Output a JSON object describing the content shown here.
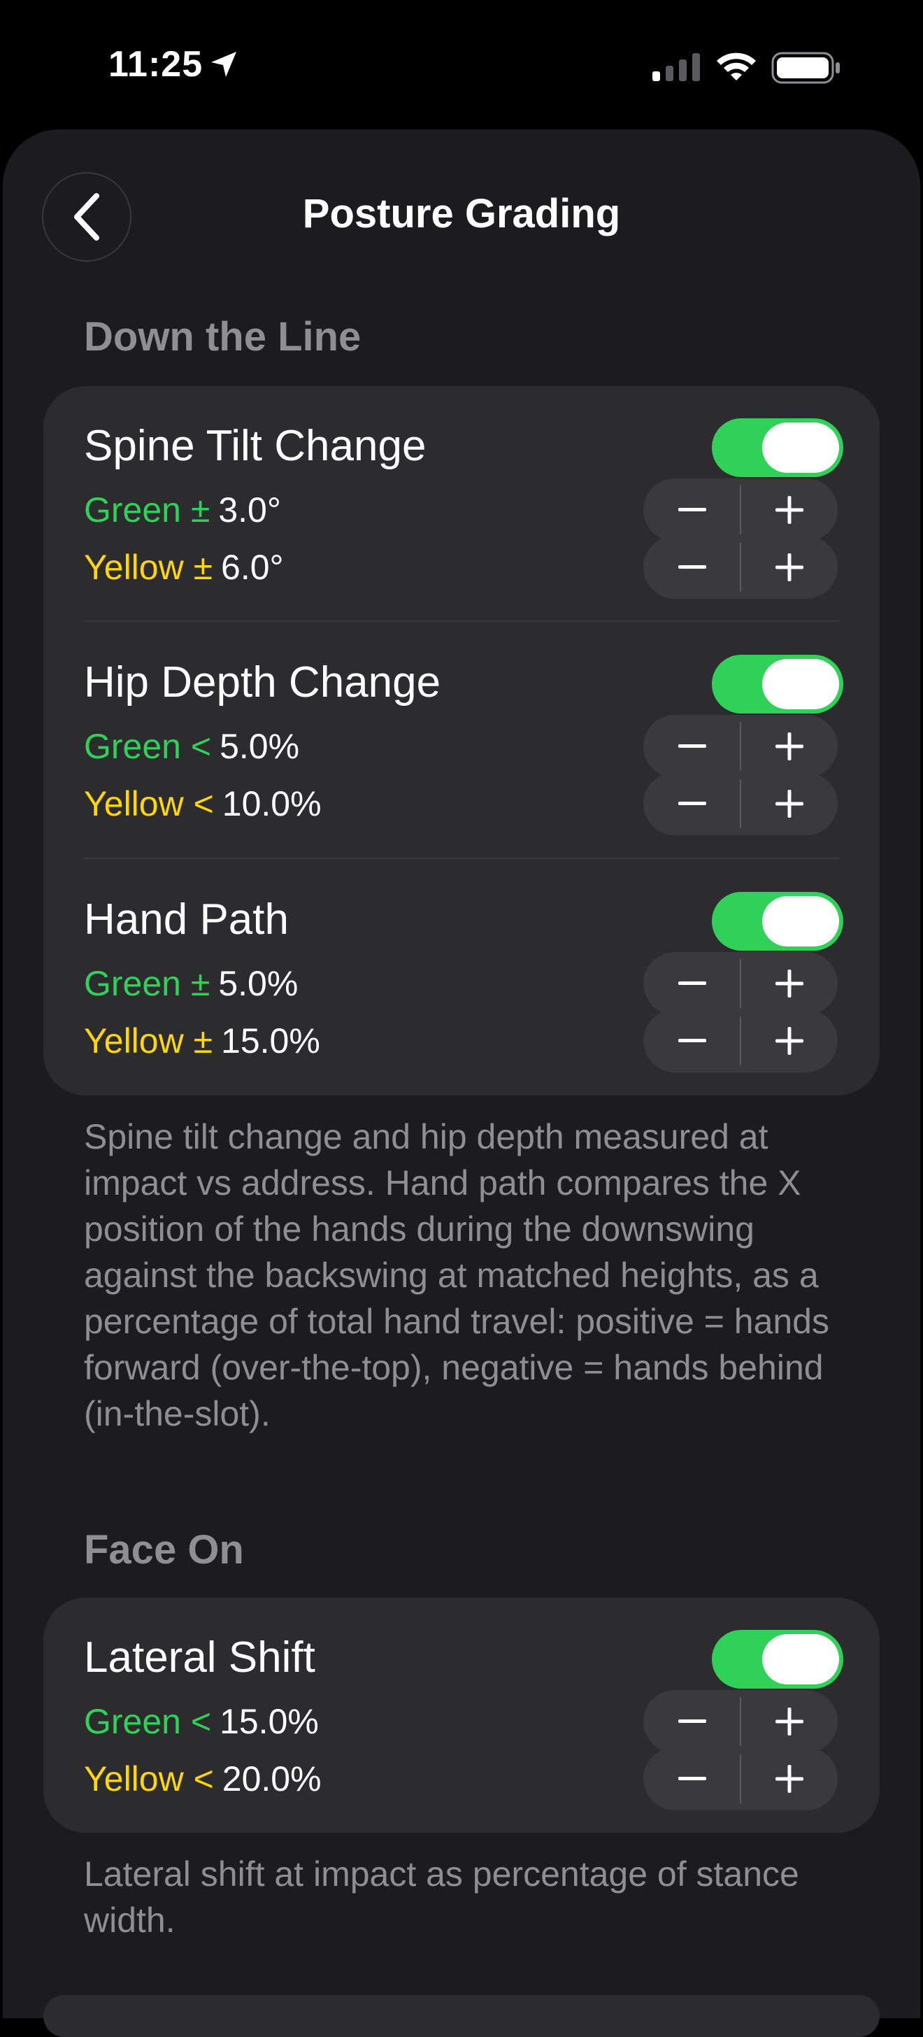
{
  "status_bar": {
    "time": "11:25"
  },
  "header": {
    "title": "Posture Grading"
  },
  "sections": [
    {
      "header": "Down the Line",
      "rows": [
        {
          "title": "Spine Tilt Change",
          "enabled": true,
          "green_label": "Green ±",
          "green_value": "3.0°",
          "yellow_label": "Yellow ±",
          "yellow_value": "6.0°"
        },
        {
          "title": "Hip Depth Change",
          "enabled": true,
          "green_label": "Green <",
          "green_value": "5.0%",
          "yellow_label": "Yellow <",
          "yellow_value": "10.0%"
        },
        {
          "title": "Hand Path",
          "enabled": true,
          "green_label": "Green ±",
          "green_value": "5.0%",
          "yellow_label": "Yellow ±",
          "yellow_value": "15.0%"
        }
      ],
      "footnote": "Spine tilt change and hip depth measured at impact vs address. Hand path compares the X position of the hands during the downswing against the backswing at matched heights, as a percentage of total hand travel: positive = hands forward (over-the-top), negative = hands behind (in-the-slot)."
    },
    {
      "header": "Face On",
      "rows": [
        {
          "title": "Lateral Shift",
          "enabled": true,
          "green_label": "Green <",
          "green_value": "15.0%",
          "yellow_label": "Yellow <",
          "yellow_value": "20.0%"
        }
      ],
      "footnote": "Lateral shift at impact as percentage of stance width."
    }
  ],
  "colors": {
    "green": "#30d158",
    "yellow": "#ffd60a",
    "card": "#2c2c2e",
    "sheet": "#1c1c1e"
  },
  "icons": [
    "location-arrow-icon",
    "cellular-signal-icon",
    "wifi-icon",
    "battery-icon",
    "chevron-left-icon",
    "minus-icon",
    "plus-icon"
  ]
}
